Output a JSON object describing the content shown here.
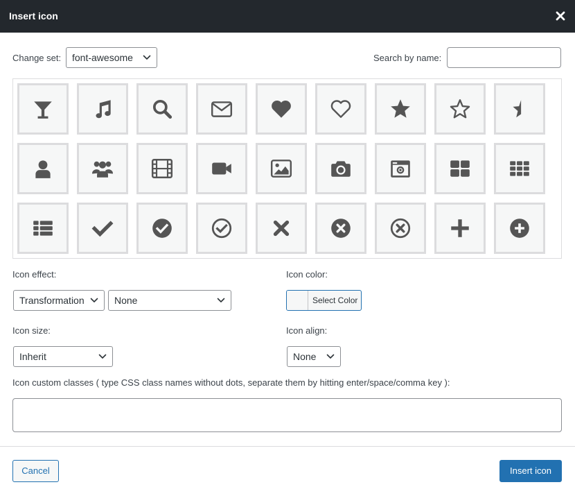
{
  "dialog": {
    "title": "Insert icon"
  },
  "set_picker": {
    "label": "Change set:",
    "value": "font-awesome"
  },
  "search": {
    "label": "Search by name:",
    "value": "",
    "placeholder": ""
  },
  "icons": [
    "glass-icon",
    "music-icon",
    "search-icon",
    "envelope-icon",
    "heart-icon",
    "heart-outline-icon",
    "star-icon",
    "star-outline-icon",
    "star-half-icon",
    "user-icon",
    "users-icon",
    "film-icon",
    "video-camera-icon",
    "picture-icon",
    "camera-icon",
    "camera-retro-icon",
    "th-large-icon",
    "th-icon",
    "th-list-icon",
    "check-icon",
    "check-circle-icon",
    "check-circle-outline-icon",
    "times-icon",
    "times-circle-icon",
    "times-circle-outline-icon",
    "plus-icon",
    "plus-circle-icon"
  ],
  "effect": {
    "label": "Icon effect:",
    "type_value": "Transformation",
    "value": "None"
  },
  "color": {
    "label": "Icon color:",
    "button_label": "Select Color",
    "current": "#f6f7f7"
  },
  "size": {
    "label": "Icon size:",
    "value": "Inherit"
  },
  "align": {
    "label": "Icon align:",
    "value": "None"
  },
  "custom_classes": {
    "label": "Icon custom classes ( type CSS class names without dots, separate them by hitting enter/space/comma key ):",
    "value": ""
  },
  "footer": {
    "cancel_label": "Cancel",
    "insert_label": "Insert icon"
  },
  "colors": {
    "titlebar": "#23282d",
    "accent": "#2271b1",
    "icon": "#555555",
    "cell_bg": "#f6f7f7",
    "cell_border": "#dcdcde"
  }
}
